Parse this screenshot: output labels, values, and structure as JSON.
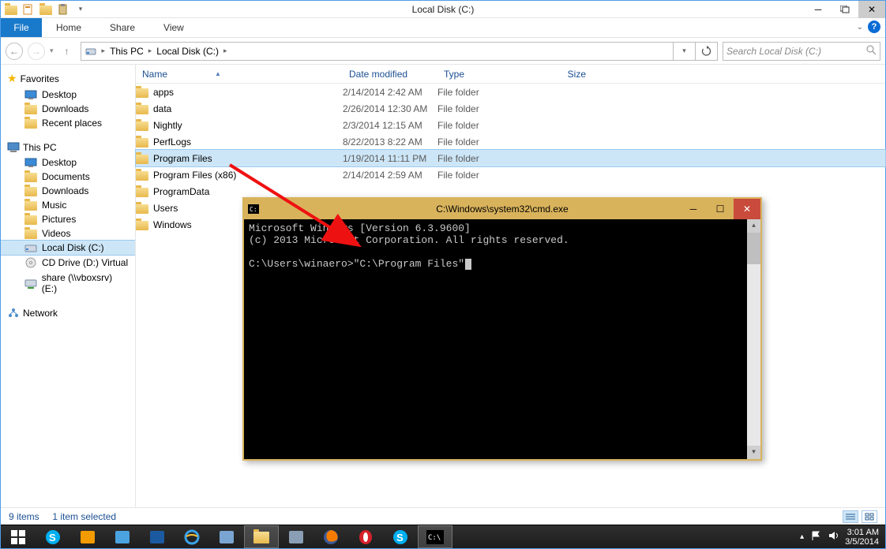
{
  "window": {
    "title": "Local Disk (C:)"
  },
  "ribbon": {
    "file": "File",
    "home": "Home",
    "share": "Share",
    "view": "View"
  },
  "address": {
    "root": "This PC",
    "current": "Local Disk (C:)"
  },
  "search": {
    "placeholder": "Search Local Disk (C:)"
  },
  "columns": {
    "name": "Name",
    "date": "Date modified",
    "type": "Type",
    "size": "Size"
  },
  "favorites": {
    "header": "Favorites",
    "items": [
      "Desktop",
      "Downloads",
      "Recent places"
    ]
  },
  "thispc": {
    "header": "This PC",
    "items": [
      {
        "label": "Desktop",
        "icon": "desktop"
      },
      {
        "label": "Documents",
        "icon": "folder"
      },
      {
        "label": "Downloads",
        "icon": "folder"
      },
      {
        "label": "Music",
        "icon": "folder"
      },
      {
        "label": "Pictures",
        "icon": "folder"
      },
      {
        "label": "Videos",
        "icon": "folder"
      },
      {
        "label": "Local Disk (C:)",
        "icon": "drive",
        "selected": true
      },
      {
        "label": "CD Drive (D:) Virtual",
        "icon": "cd"
      },
      {
        "label": "share (\\\\vboxsrv) (E:)",
        "icon": "netdrive"
      }
    ]
  },
  "network": {
    "header": "Network"
  },
  "files": [
    {
      "name": "apps",
      "date": "2/14/2014 2:42 AM",
      "type": "File folder"
    },
    {
      "name": "data",
      "date": "2/26/2014 12:30 AM",
      "type": "File folder"
    },
    {
      "name": "Nightly",
      "date": "2/3/2014 12:15 AM",
      "type": "File folder"
    },
    {
      "name": "PerfLogs",
      "date": "8/22/2013 8:22 AM",
      "type": "File folder"
    },
    {
      "name": "Program Files",
      "date": "1/19/2014 11:11 PM",
      "type": "File folder",
      "selected": true
    },
    {
      "name": "Program Files (x86)",
      "date": "2/14/2014 2:59 AM",
      "type": "File folder"
    },
    {
      "name": "ProgramData",
      "date": "",
      "type": ""
    },
    {
      "name": "Users",
      "date": "",
      "type": ""
    },
    {
      "name": "Windows",
      "date": "",
      "type": ""
    }
  ],
  "status": {
    "items": "9 items",
    "selected": "1 item selected"
  },
  "cmd": {
    "title": "C:\\Windows\\system32\\cmd.exe",
    "line1": "Microsoft Windows [Version 6.3.9600]",
    "line2": "(c) 2013 Microsoft Corporation. All rights reserved.",
    "prompt": "C:\\Users\\winaero>\"C:\\Program Files\""
  },
  "tray": {
    "time": "3:01 AM",
    "date": "3/5/2014"
  }
}
